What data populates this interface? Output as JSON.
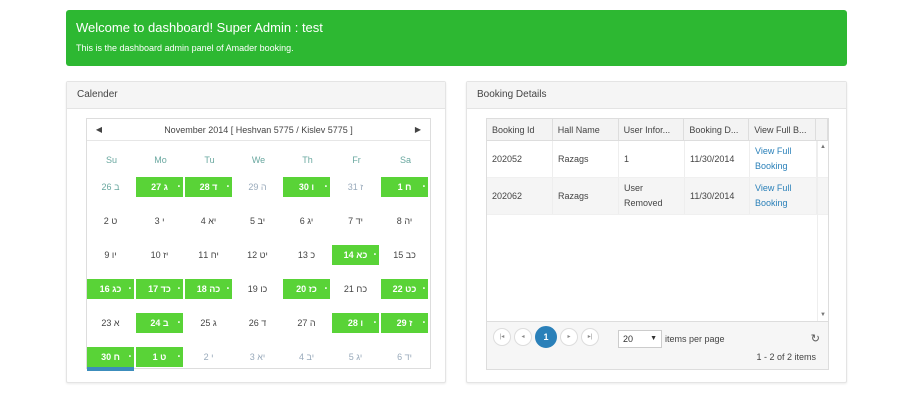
{
  "alert": {
    "title": "Welcome to dashboard! Super Admin : test",
    "subtitle": "This is the dashboard admin panel of Amader booking.",
    "color": "#2db832"
  },
  "calendar_panel": {
    "title": "Calender"
  },
  "calendar": {
    "prev_icon": "triangle-left-icon",
    "next_icon": "triangle-right-icon",
    "prev_symbol": "◀",
    "next_symbol": "▶",
    "month_label": "November 2014 [ Heshvan 5775 / Kislev 5775 ]",
    "weekdays": [
      "Su",
      "Mo",
      "Tu",
      "We",
      "Th",
      "Fr",
      "Sa"
    ],
    "booked_color": "#59d337",
    "weeks": [
      [
        {
          "t": "26 ב",
          "s": "other"
        },
        {
          "t": "27 ג",
          "s": "booked"
        },
        {
          "t": "28 ד",
          "s": "booked"
        },
        {
          "t": "29 ה",
          "s": "other"
        },
        {
          "t": "30 ו",
          "s": "booked"
        },
        {
          "t": "31 ז",
          "s": "other"
        },
        {
          "t": "1 ח",
          "s": "booked"
        }
      ],
      [
        {
          "t": "2 ט",
          "s": ""
        },
        {
          "t": "3 י",
          "s": ""
        },
        {
          "t": "4 יא",
          "s": ""
        },
        {
          "t": "5 יב",
          "s": ""
        },
        {
          "t": "6 יג",
          "s": ""
        },
        {
          "t": "7 יד",
          "s": ""
        },
        {
          "t": "8 יה",
          "s": ""
        }
      ],
      [
        {
          "t": "9 יו",
          "s": ""
        },
        {
          "t": "10 יז",
          "s": ""
        },
        {
          "t": "11 יח",
          "s": ""
        },
        {
          "t": "12 יט",
          "s": ""
        },
        {
          "t": "13 כ",
          "s": ""
        },
        {
          "t": "14 כא",
          "s": "booked"
        },
        {
          "t": "15 כב",
          "s": ""
        }
      ],
      [
        {
          "t": "16 כג",
          "s": "booked"
        },
        {
          "t": "17 כד",
          "s": "booked"
        },
        {
          "t": "18 כה",
          "s": "booked"
        },
        {
          "t": "19 כו",
          "s": ""
        },
        {
          "t": "20 כז",
          "s": "booked"
        },
        {
          "t": "21 כח",
          "s": ""
        },
        {
          "t": "22 כט",
          "s": "booked"
        }
      ],
      [
        {
          "t": "23 א",
          "s": ""
        },
        {
          "t": "24 ב",
          "s": "booked"
        },
        {
          "t": "25 ג",
          "s": ""
        },
        {
          "t": "26 ד",
          "s": ""
        },
        {
          "t": "27 ה",
          "s": ""
        },
        {
          "t": "28 ו",
          "s": "booked"
        },
        {
          "t": "29 ז",
          "s": "booked"
        }
      ],
      [
        {
          "t": "30 ח",
          "s": "booked today"
        },
        {
          "t": "1 ט",
          "s": "booked"
        },
        {
          "t": "2 י",
          "s": "other"
        },
        {
          "t": "3 יא",
          "s": "other"
        },
        {
          "t": "4 יב",
          "s": "other"
        },
        {
          "t": "5 יג",
          "s": "other"
        },
        {
          "t": "6 יד",
          "s": "other"
        }
      ]
    ]
  },
  "booking_panel": {
    "title": "Booking Details"
  },
  "grid": {
    "columns": [
      "Booking Id",
      "Hall Name",
      "User Infor...",
      "Booking D...",
      "View Full B..."
    ],
    "rows": [
      [
        "202052",
        "Razags",
        "1",
        "11/30/2014",
        "View Full Booking"
      ],
      [
        "202062",
        "Razags",
        "User Removed",
        "11/30/2014",
        "View Full Booking"
      ]
    ],
    "pager": {
      "first_symbol": "|◂",
      "prev_symbol": "◂",
      "current_page": "1",
      "next_symbol": "▸",
      "last_symbol": "▸|",
      "page_size": "20",
      "select_arrow": "▼",
      "page_size_label": "items per page",
      "refresh_symbol": "↻",
      "info": "1 - 2 of 2 items",
      "active_color": "#2a80b9"
    }
  }
}
